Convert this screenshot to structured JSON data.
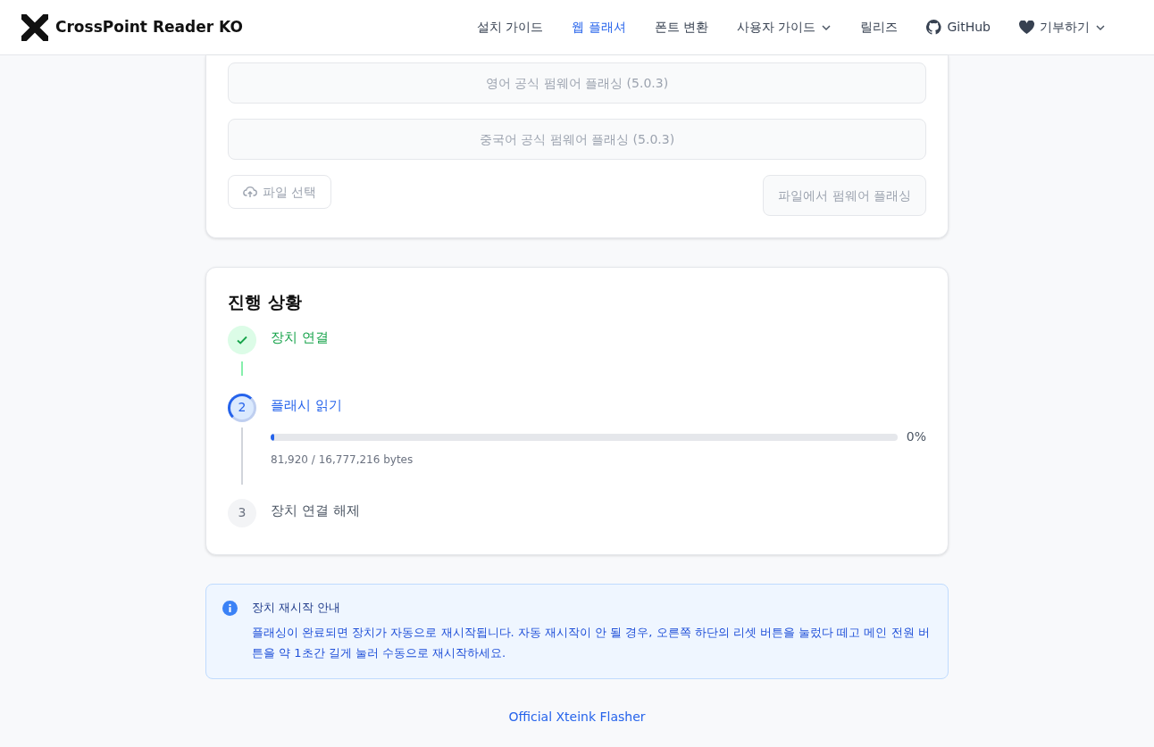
{
  "brand": {
    "name": "CrossPoint Reader KO"
  },
  "nav": [
    {
      "label": "설치 가이드",
      "selected": false,
      "dropdown": false
    },
    {
      "label": "웹 플래셔",
      "selected": true,
      "dropdown": false
    },
    {
      "label": "폰트 변환",
      "selected": false,
      "dropdown": false
    },
    {
      "label": "사용자 가이드",
      "selected": false,
      "dropdown": true
    },
    {
      "label": "릴리즈",
      "selected": false,
      "dropdown": false
    },
    {
      "label": "GitHub",
      "selected": false,
      "dropdown": false,
      "kind": "github"
    },
    {
      "label": "기부하기",
      "selected": false,
      "dropdown": true,
      "kind": "heart"
    }
  ],
  "flash_card": {
    "buttons": [
      {
        "label": "영어 공식 펌웨어 플래싱 (5.0.3)",
        "disabled": true
      },
      {
        "label": "중국어 공식 펌웨어 플래싱 (5.0.3)",
        "disabled": true
      }
    ],
    "file_button": {
      "label": "파일 선택",
      "disabled": true
    },
    "flash_file_button": {
      "label": "파일에서 펌웨어 플래싱",
      "disabled": true
    }
  },
  "progress": {
    "title": "진행 상황",
    "steps": [
      {
        "label": "장치 연결",
        "completed": true,
        "current": false
      },
      {
        "number": "2",
        "label": "플래시 읽기",
        "completed": false,
        "current": true,
        "level": 0.005,
        "reading": "0%",
        "detail": "81,920 / 16,777,216 bytes"
      },
      {
        "number": "3",
        "label": "장치 연결 해제",
        "completed": false,
        "current": false
      }
    ]
  },
  "notice": {
    "title": "장치 재시작 안내",
    "text": "플래싱이 완료되면 장치가 자동으로 재시작됩니다. 자동 재시작이 안 될 경우, 오른쪽 하단의 리셋 버튼을 눌렀다 떼고 메인 전원 버튼을 약 1초간 길게 눌러 수동으로 재시작하세요."
  },
  "footer": {
    "link": "Official Xteink Flasher"
  }
}
